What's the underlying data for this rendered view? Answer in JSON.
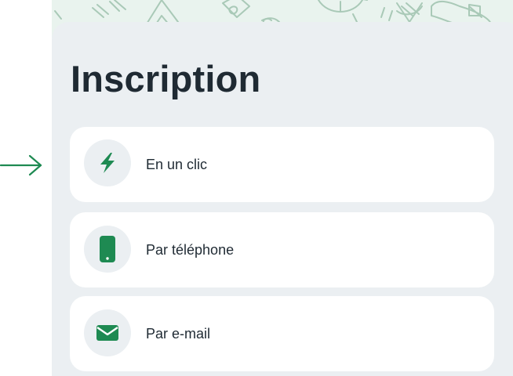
{
  "header": {
    "title": "Inscription"
  },
  "options": [
    {
      "label": "En un clic",
      "icon": "lightning-bolt-icon"
    },
    {
      "label": "Par téléphone",
      "icon": "smartphone-icon"
    },
    {
      "label": "Par e-mail",
      "icon": "envelope-icon"
    }
  ],
  "pointer": {
    "icon": "right-arrow-icon"
  },
  "colors": {
    "accent": "#1e8a52",
    "panel": "#ebeff2",
    "card": "#ffffff",
    "text": "#1f2a33",
    "pattern_bg": "#e9f3ee",
    "pattern_stroke": "#a9c9b7"
  }
}
